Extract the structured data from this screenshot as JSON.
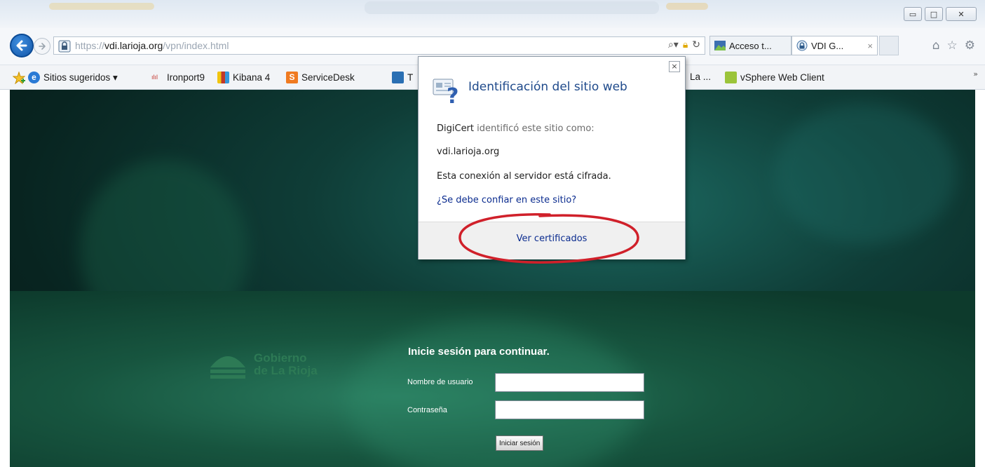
{
  "window": {
    "controls": {
      "minimize": "▭",
      "maximize": "□",
      "close": "✕"
    }
  },
  "navigation": {
    "address": {
      "scheme": "https://",
      "host": "vdi.larioja.org",
      "path": "/vpn/index.html"
    },
    "tabs": [
      {
        "label": "Acceso t...",
        "icon": "site-icon"
      },
      {
        "label": "VDI G...",
        "icon": "lock-icon",
        "close": "×"
      }
    ],
    "right_icons": [
      "home-icon",
      "star-icon",
      "gear-icon"
    ]
  },
  "favorites": {
    "items": [
      {
        "label": "Sitios sugeridos ▾",
        "icon": "ie-icon"
      },
      {
        "label": "Ironport9",
        "icon": "cisco-icon"
      },
      {
        "label": "Kibana 4",
        "icon": "kibana-icon"
      },
      {
        "label": "ServiceDesk",
        "icon": "servicedesk-icon"
      },
      {
        "label": "T",
        "icon": "t-icon"
      },
      {
        "label": "La ...",
        "icon": ""
      },
      {
        "label": "vSphere Web Client",
        "icon": "vsphere-icon"
      }
    ],
    "more": "»"
  },
  "popup": {
    "title": "Identificación del sitio web",
    "issuer": "DigiCert",
    "issuer_text": " identificó este sitio como:",
    "site": "vdi.larioja.org",
    "encryption": "Esta conexión al servidor está cifrada.",
    "trust_link": "¿Se debe confiar en este sitio?",
    "view_certificates": "Ver certificados",
    "close": "×"
  },
  "login": {
    "logo_line1": "Gobierno",
    "logo_line2": "de La Rioja",
    "title": "Inicie sesión para continuar.",
    "username_label": "Nombre de usuario",
    "password_label": "Contraseña",
    "username_value": "",
    "password_value": "",
    "submit_label": "Iniciar sesión"
  },
  "colors": {
    "link": "#0b2c8f",
    "popup_title": "#1f4a8b",
    "highlight": "#d0202a",
    "page_background": "#0f3d37"
  }
}
